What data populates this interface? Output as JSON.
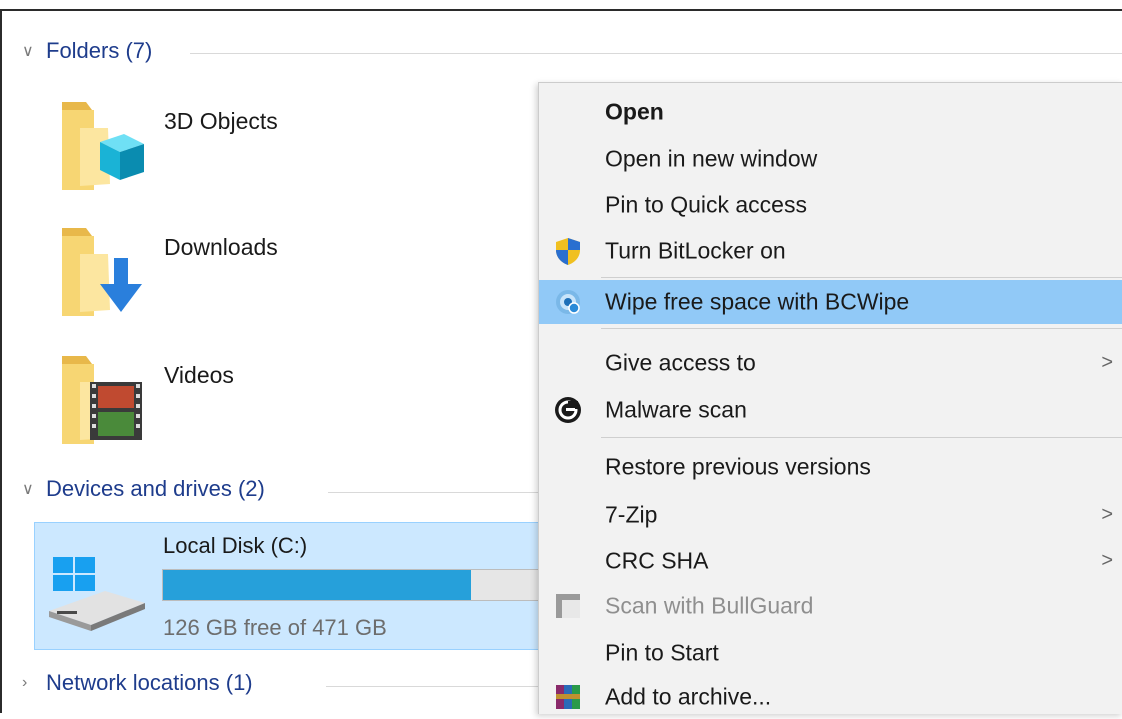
{
  "sections": {
    "folders": {
      "title": "Folders (7)"
    },
    "devices": {
      "title": "Devices and drives (2)"
    },
    "network": {
      "title": "Network locations (1)"
    }
  },
  "folders": [
    {
      "label": "3D Objects",
      "icon": "3d-objects-folder-icon"
    },
    {
      "label": "Downloads",
      "icon": "downloads-folder-icon"
    },
    {
      "label": "Videos",
      "icon": "videos-folder-icon"
    }
  ],
  "drive": {
    "label": "Local Disk (C:)",
    "space": "126 GB free of 471 GB",
    "used_fraction": 0.733,
    "icon": "windows-drive-icon"
  },
  "context_menu": {
    "items": [
      {
        "label": "Open",
        "bold": true
      },
      {
        "label": "Open in new window"
      },
      {
        "label": "Pin to Quick access"
      },
      {
        "label": "Turn BitLocker on",
        "icon": "shield-icon"
      },
      {
        "label": "Wipe free space with BCWipe",
        "icon": "bcwipe-icon",
        "highlighted": true
      },
      {
        "label": "Give access to",
        "submenu": true
      },
      {
        "label": "Malware scan",
        "icon": "malware-scan-icon"
      },
      {
        "label": "Restore previous versions"
      },
      {
        "label": "7-Zip",
        "submenu": true
      },
      {
        "label": "CRC SHA",
        "submenu": true
      },
      {
        "label": "Scan with BullGuard",
        "icon": "bullguard-icon",
        "disabled": true
      },
      {
        "label": "Pin to Start"
      },
      {
        "label": "Add to archive...",
        "icon": "winrar-archive-icon"
      }
    ],
    "submenu_arrow": ">"
  },
  "colors": {
    "section_header": "#1e3c8c",
    "highlight": "#91c9f7",
    "selection": "#cce8ff",
    "drive_fill": "#26a0da"
  }
}
